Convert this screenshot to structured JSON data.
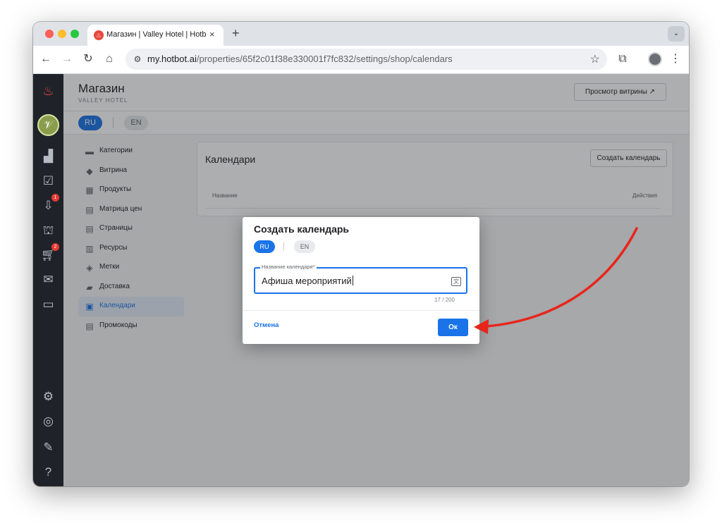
{
  "browser": {
    "tab_title": "Магазин | Valley Hotel | Hotbot",
    "url_host": "my.hotbot.ai",
    "url_path": "/properties/65f2c01f38e330001f7fc832/settings/shop/calendars",
    "new_tab": "+",
    "tab_close": "×"
  },
  "header": {
    "title": "Магазин",
    "subtitle": "VALLEY HOTEL",
    "preview_button": "Просмотр витрины ↗"
  },
  "languages": {
    "ru": "RU",
    "en": "EN"
  },
  "rail": {
    "badges": {
      "inbox": "1",
      "cart": "2"
    }
  },
  "menu": {
    "items": [
      {
        "label": "Категории",
        "icon": "categories-icon",
        "glyph": "▬"
      },
      {
        "label": "Витрина",
        "icon": "showcase-icon",
        "glyph": "◆"
      },
      {
        "label": "Продукты",
        "icon": "products-icon",
        "glyph": "▦"
      },
      {
        "label": "Матрица цен",
        "icon": "price-matrix-icon",
        "glyph": "▤"
      },
      {
        "label": "Страницы",
        "icon": "pages-icon",
        "glyph": "▤"
      },
      {
        "label": "Ресурсы",
        "icon": "resources-icon",
        "glyph": "▥"
      },
      {
        "label": "Метки",
        "icon": "tags-icon",
        "glyph": "◈"
      },
      {
        "label": "Доставка",
        "icon": "delivery-icon",
        "glyph": "▰"
      },
      {
        "label": "Календари",
        "icon": "calendar-icon",
        "glyph": "▣",
        "active": true
      },
      {
        "label": "Промокоды",
        "icon": "promocodes-icon",
        "glyph": "▤"
      }
    ]
  },
  "panel": {
    "title": "Календари",
    "create_button": "Создать календарь",
    "columns": {
      "name": "Название",
      "actions": "Действия"
    }
  },
  "modal": {
    "title": "Создать календарь",
    "lang_ru": "RU",
    "lang_en": "EN",
    "field_label": "Название календаря*",
    "field_value": "Афиша мероприятий",
    "counter": "17 / 200",
    "cancel": "Отмена",
    "ok": "Ок"
  },
  "colors": {
    "primary": "#1a73e8",
    "rail": "#1f2329",
    "annotation_arrow": "#e8251b"
  }
}
